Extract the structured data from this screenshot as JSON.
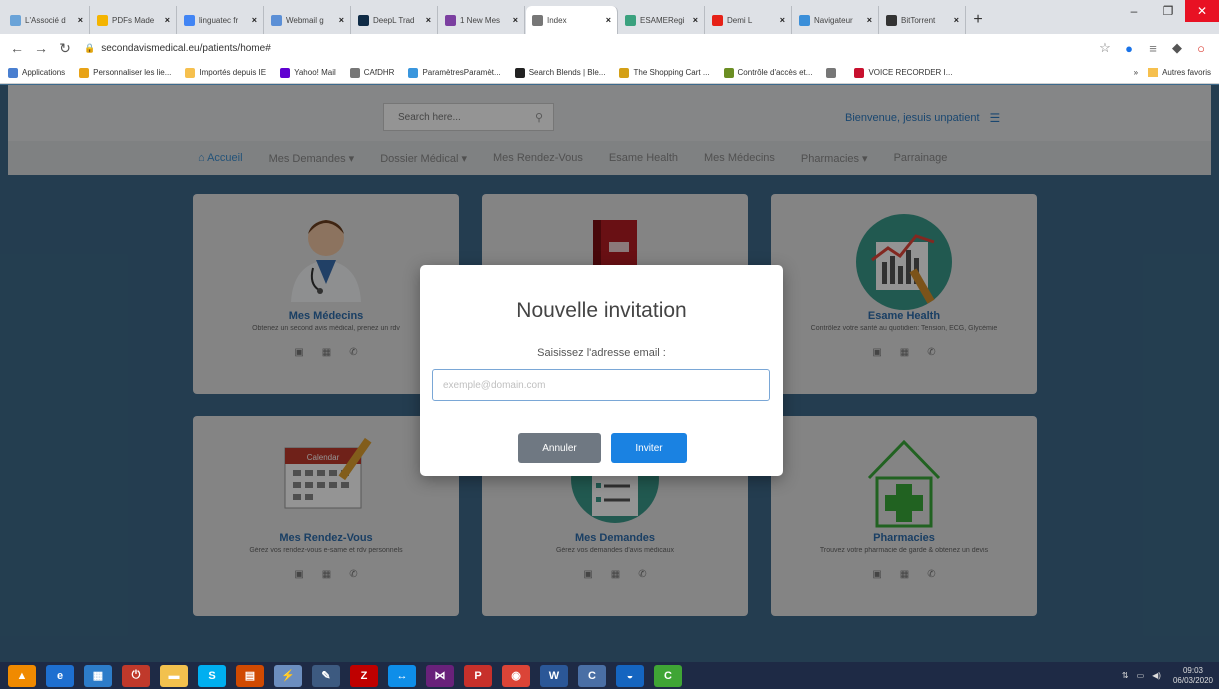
{
  "browser": {
    "tabs": [
      {
        "title": "L'Associé d",
        "color": "#6aa3d8"
      },
      {
        "title": "PDFs Made",
        "color": "#f4b400"
      },
      {
        "title": "linguatec fr",
        "color": "#4285f4"
      },
      {
        "title": "Webmail g",
        "color": "#5b8fd6"
      },
      {
        "title": "DeepL Trad",
        "color": "#0f2b46"
      },
      {
        "title": "1 New Mes",
        "color": "#7b3fa0"
      },
      {
        "title": "Index",
        "color": "#777777",
        "active": true
      },
      {
        "title": "ESAMERegi",
        "color": "#3aa17e"
      },
      {
        "title": "Demi L",
        "color": "#e62117"
      },
      {
        "title": "Navigateur",
        "color": "#3b8fd9"
      },
      {
        "title": "BitTorrent",
        "color": "#333333"
      }
    ],
    "new_tab_label": "+",
    "window_controls": [
      "–",
      "❐",
      "✕"
    ],
    "url": "secondavismedical.eu/patients/home#",
    "bookmarks": [
      {
        "label": "Applications",
        "color": "#4a7fd0"
      },
      {
        "label": "Personnaliser les lie...",
        "color": "#e8a317"
      },
      {
        "label": "Importés depuis IE",
        "color": "#f6c04e"
      },
      {
        "label": "Yahoo! Mail",
        "color": "#5f01d1"
      },
      {
        "label": "CAfDHR",
        "color": "#777777"
      },
      {
        "label": "ParamètresParamèt...",
        "color": "#3a96dd"
      },
      {
        "label": "Search Blends | Ble...",
        "color": "#222222"
      },
      {
        "label": "The Shopping Cart ...",
        "color": "#d4a017"
      },
      {
        "label": "Contrôle d'accès et...",
        "color": "#6b8e23"
      },
      {
        "label": "",
        "color": "#777777"
      },
      {
        "label": "VOICE RECORDER I...",
        "color": "#c8102e"
      }
    ],
    "bookmarks_more": "»",
    "other_bookmarks": "Autres favoris"
  },
  "header": {
    "search_placeholder": "Search here...",
    "welcome": "Bienvenue, jesuis unpatient",
    "menu_icon": "☰"
  },
  "nav": {
    "items": [
      {
        "label": "⌂ Accueil",
        "active": true
      },
      {
        "label": "Mes Demandes ▾"
      },
      {
        "label": "Dossier Médical ▾"
      },
      {
        "label": "Mes Rendez-Vous"
      },
      {
        "label": "Esame Health"
      },
      {
        "label": "Mes Médecins"
      },
      {
        "label": "Pharmacies ▾"
      },
      {
        "label": "Parrainage"
      }
    ]
  },
  "cards": [
    {
      "title": "Mes Médecins",
      "desc": "Obtenez un second avis médical, prenez un rdv",
      "icon": "doctor-icon"
    },
    {
      "title": "",
      "desc": "",
      "icon": "folder-icon"
    },
    {
      "title": "Esame Health",
      "desc": "Contrôlez votre santé au quotidien: Tension, ECG, Glycémie",
      "icon": "health-chart-icon"
    },
    {
      "title": "Mes Rendez-Vous",
      "desc": "Gérez vos rendez-vous e-same et rdv personnels",
      "icon": "calendar-icon"
    },
    {
      "title": "Mes Demandes",
      "desc": "Gérez vos demandes d'avis médicaux",
      "icon": "checklist-icon"
    },
    {
      "title": "Pharmacies",
      "desc": "Trouvez votre pharmacie de garde & obtenez un devis",
      "icon": "pharmacy-icon"
    }
  ],
  "card_icons": [
    "▣",
    "▦",
    "✆"
  ],
  "calendar_label": "Calendar",
  "modal": {
    "title": "Nouvelle invitation",
    "label": "Saisissez l'adresse email :",
    "placeholder": "exemple@domain.com",
    "cancel": "Annuler",
    "invite": "Inviter"
  },
  "taskbar": {
    "apps": [
      {
        "name": "vlc-icon",
        "color": "#f08a00",
        "glyph": "▲"
      },
      {
        "name": "internet-explorer-icon",
        "color": "#1e6fd0",
        "glyph": "e"
      },
      {
        "name": "app-icon",
        "color": "#2d7cc9",
        "glyph": "▦"
      },
      {
        "name": "power-icon",
        "color": "#c0392b",
        "glyph": "⏻"
      },
      {
        "name": "file-explorer-icon",
        "color": "#f2c14e",
        "glyph": "▬"
      },
      {
        "name": "skype-icon",
        "color": "#00aff0",
        "glyph": "S"
      },
      {
        "name": "office-icon",
        "color": "#d04a02",
        "glyph": "▤"
      },
      {
        "name": "network-icon",
        "color": "#6c8ebf",
        "glyph": "⚡"
      },
      {
        "name": "pen-icon",
        "color": "#3d5a80",
        "glyph": "✎"
      },
      {
        "name": "filezilla-icon",
        "color": "#bf0000",
        "glyph": "Z"
      },
      {
        "name": "teamviewer-icon",
        "color": "#0e8ee9",
        "glyph": "↔"
      },
      {
        "name": "visual-studio-icon",
        "color": "#68217a",
        "glyph": "⋈"
      },
      {
        "name": "pdf-icon",
        "color": "#c7302b",
        "glyph": "P"
      },
      {
        "name": "chrome-icon",
        "color": "#db4437",
        "glyph": "◉"
      },
      {
        "name": "word-icon",
        "color": "#2b5797",
        "glyph": "W"
      },
      {
        "name": "ccleaner-icon",
        "color": "#4a6fa5",
        "glyph": "C"
      },
      {
        "name": "utility-icon",
        "color": "#1565c0",
        "glyph": "◒"
      },
      {
        "name": "camtasia-icon",
        "color": "#3fa535",
        "glyph": "C"
      }
    ],
    "clock_time": "09:03",
    "clock_date": "06/03/2020"
  }
}
